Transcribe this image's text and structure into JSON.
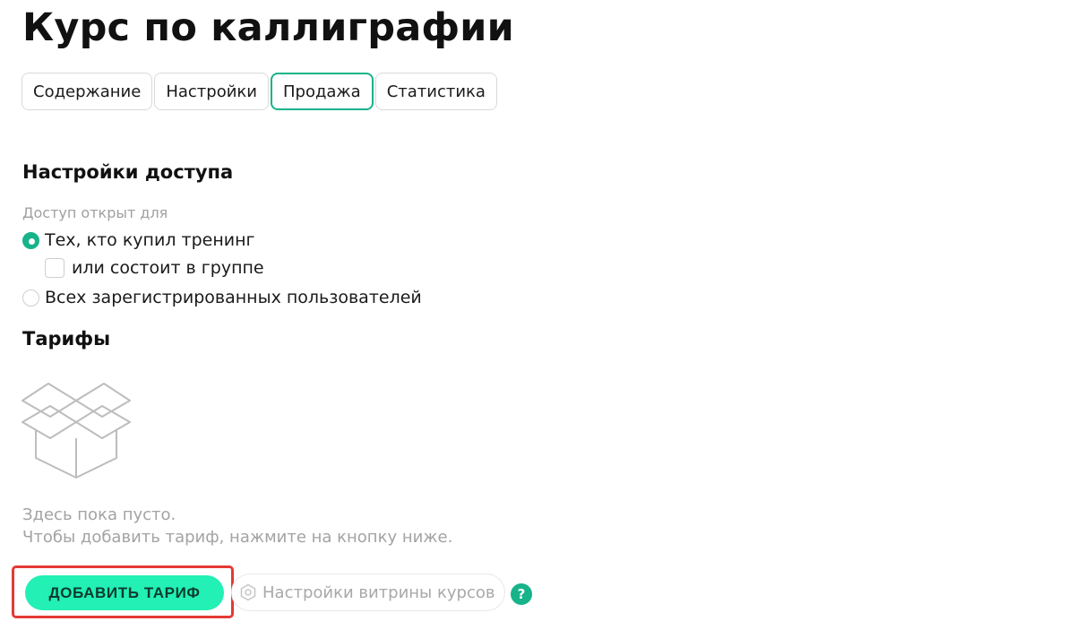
{
  "page": {
    "title": "Курс по каллиграфии"
  },
  "tabs": [
    {
      "label": "Содержание",
      "active": false
    },
    {
      "label": "Настройки",
      "active": false
    },
    {
      "label": "Продажа",
      "active": true
    },
    {
      "label": "Статистика",
      "active": false
    }
  ],
  "access": {
    "title": "Настройки доступа",
    "open_for_label": "Доступ открыт для",
    "options": [
      {
        "label": "Тех, кто купил тренинг",
        "checked": true
      },
      {
        "label": "Всех зарегистрированных пользователей",
        "checked": false
      }
    ],
    "group_checkbox": {
      "label": "или состоит в группе",
      "checked": false
    }
  },
  "tariffs": {
    "title": "Тарифы",
    "empty_line1": "Здесь пока пусто.",
    "empty_line2": "Чтобы добавить тариф, нажмите на кнопку ниже.",
    "add_button": "ДОБАВИТЬ ТАРИФ",
    "showcase_button": "Настройки витрины курсов",
    "help_icon": "?"
  },
  "colors": {
    "accent": "#17b38a",
    "add_button_bg": "#22f0b5",
    "highlight_border": "#e53935"
  }
}
